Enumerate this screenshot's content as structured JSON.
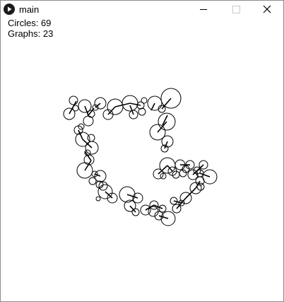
{
  "window": {
    "title": "main",
    "icons": {
      "app": "play-icon",
      "minimize": "minimize-icon",
      "maximize": "maximize-icon",
      "close": "close-icon"
    }
  },
  "stats": {
    "circles_text": "Circles: 69",
    "graphs_text": "Graphs: 23"
  },
  "colors": {
    "background": "#ffffff",
    "stroke": "#000000",
    "disabled_button": "#c8c8c8"
  }
}
